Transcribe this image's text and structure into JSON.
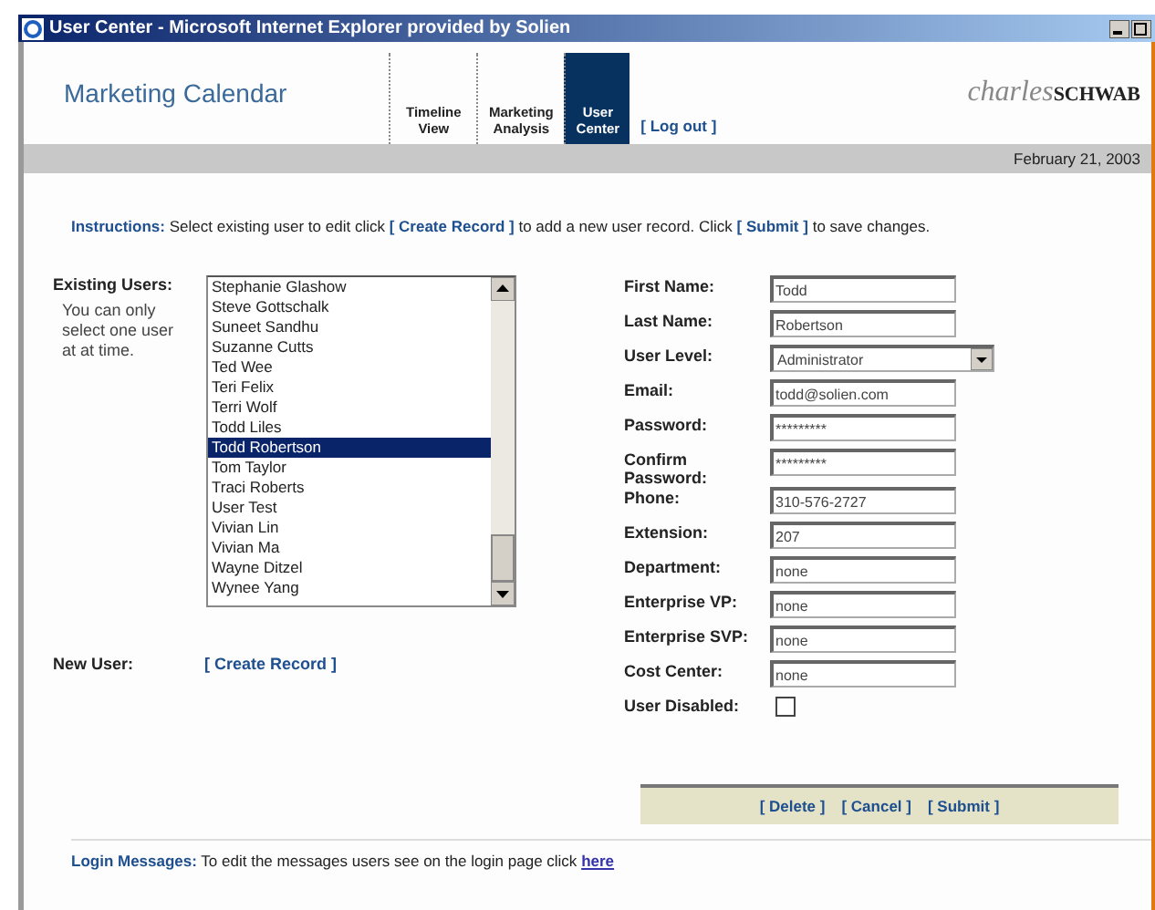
{
  "window": {
    "title": "User Center - Microsoft Internet Explorer provided by Solien"
  },
  "header": {
    "app_title": "Marketing Calendar",
    "tabs": [
      {
        "label": "Timeline View",
        "selected": false
      },
      {
        "label": "Marketing Analysis",
        "selected": false
      },
      {
        "label": "User Center",
        "selected": true
      }
    ],
    "logout": "[ Log out ]",
    "logo": {
      "script": "charles",
      "bold": "SCHWAB"
    }
  },
  "date": "February 21, 2003",
  "instructions": {
    "label": "Instructions:",
    "parts": [
      {
        "kind": "text",
        "text": "Select existing user to edit click"
      },
      {
        "kind": "link",
        "text": "[ Create Record ]"
      },
      {
        "kind": "text",
        "text": "to add a new user record. Click"
      },
      {
        "kind": "link",
        "text": "[ Submit ]"
      },
      {
        "kind": "text",
        "text": "to save changes."
      }
    ]
  },
  "existing_users": {
    "label": "Existing Users:",
    "hint": "You can only select one user at at time.",
    "items": [
      {
        "name": "Stephanie Glashow",
        "selected": false
      },
      {
        "name": "Steve Gottschalk",
        "selected": false
      },
      {
        "name": "Suneet Sandhu",
        "selected": false
      },
      {
        "name": "Suzanne Cutts",
        "selected": false
      },
      {
        "name": "Ted Wee",
        "selected": false
      },
      {
        "name": "Teri Felix",
        "selected": false
      },
      {
        "name": "Terri Wolf",
        "selected": false
      },
      {
        "name": "Todd Liles",
        "selected": false
      },
      {
        "name": "Todd Robertson",
        "selected": true
      },
      {
        "name": "Tom Taylor",
        "selected": false
      },
      {
        "name": "Traci Roberts",
        "selected": false
      },
      {
        "name": "User Test",
        "selected": false
      },
      {
        "name": "Vivian Lin",
        "selected": false
      },
      {
        "name": "Vivian Ma",
        "selected": false
      },
      {
        "name": "Wayne Ditzel",
        "selected": false
      },
      {
        "name": "Wynee Yang",
        "selected": false
      }
    ]
  },
  "new_user": {
    "label": "New User:",
    "link": "[ Create Record ]"
  },
  "form": [
    {
      "label": "First Name:",
      "kind": "text",
      "value": "Todd"
    },
    {
      "label": "Last Name:",
      "kind": "text",
      "value": "Robertson"
    },
    {
      "label": "User Level:",
      "kind": "select",
      "value": "Administrator"
    },
    {
      "label": "Email:",
      "kind": "text",
      "value": "todd@solien.com"
    },
    {
      "label": "Password:",
      "kind": "text",
      "value": "*********"
    },
    {
      "label": "Confirm Password:",
      "kind": "text",
      "value": "*********"
    },
    {
      "label": "Phone:",
      "kind": "text",
      "value": "310-576-2727"
    },
    {
      "label": "Extension:",
      "kind": "text",
      "value": "207"
    },
    {
      "label": "Department:",
      "kind": "text",
      "value": "none"
    },
    {
      "label": "Enterprise VP:",
      "kind": "text",
      "value": "none"
    },
    {
      "label": "Enterprise SVP:",
      "kind": "text",
      "value": "none"
    },
    {
      "label": "Cost Center:",
      "kind": "text",
      "value": "none"
    },
    {
      "label": "User Disabled:",
      "kind": "checkbox",
      "checked": false
    }
  ],
  "actions": [
    "[ Delete ]",
    "[ Cancel ]",
    "[ Submit ]"
  ],
  "login_messages": {
    "label": "Login Messages:",
    "text": "To edit the messages users see on the login page click",
    "link": "here"
  }
}
